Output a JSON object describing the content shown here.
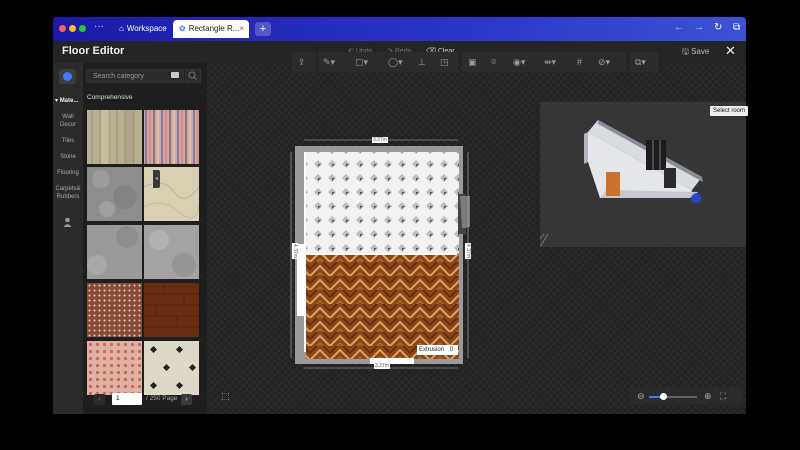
{
  "browser": {
    "tabs": [
      {
        "label": "Workspace"
      },
      {
        "label": "Rectangle R..."
      }
    ],
    "new_tab": "+"
  },
  "header": {
    "title": "Floor Editor",
    "undo": "Undo",
    "redo": "Redo",
    "clear": "Clear",
    "save": "Save"
  },
  "sidebar": {
    "section": "Mate...",
    "items": [
      {
        "label": "Wall Decor"
      },
      {
        "label": "Tiles"
      },
      {
        "label": "Stone"
      },
      {
        "label": "Flooring"
      },
      {
        "label": "Carpets& Rubbers"
      }
    ]
  },
  "catalog": {
    "search_placeholder": "Search category",
    "heading": "Comprehensive",
    "materials": [
      {
        "name": "wood-planks",
        "color": "#b9b094"
      },
      {
        "name": "striped-fabric",
        "color": "#b48d8a"
      },
      {
        "name": "grey-granite",
        "color": "#8d8d8d"
      },
      {
        "name": "beige-marble",
        "color": "#d9cfb2"
      },
      {
        "name": "concrete",
        "color": "#9a9a9a"
      },
      {
        "name": "grey-stone",
        "color": "#a3a3a3"
      },
      {
        "name": "dotted-brown",
        "color": "#8a4b35"
      },
      {
        "name": "dark-wood",
        "color": "#6b2d12"
      },
      {
        "name": "pink-tile",
        "color": "#e0b1a3"
      },
      {
        "name": "cream-octagon",
        "color": "#ddd8c8"
      }
    ],
    "pagination": {
      "current": "1",
      "total": "/ 250 Page"
    }
  },
  "plan": {
    "dim_top": "3.27m",
    "dim_bottom": "3.27m",
    "dim_left": "4.37m",
    "dim_right": "4.37m",
    "extrusion_label": "Extrusion",
    "extrusion_value": "0"
  },
  "preview": {
    "select_room": "Select room"
  },
  "colors": {
    "accent": "#3d7bff",
    "browser_bar": "#2a36c9",
    "floor_wood": "#8a4519"
  }
}
